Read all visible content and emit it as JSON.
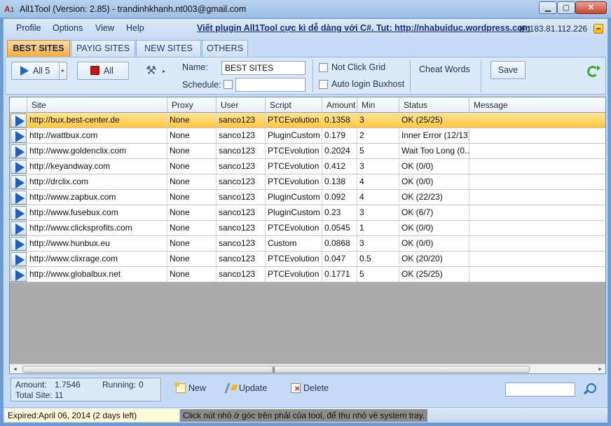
{
  "window": {
    "title": "All1Tool (Version: 2.85) - trandinhkhanh.nt003@gmail.com",
    "logo": "A1",
    "min_glyph": "▁",
    "max_glyph": "▢",
    "close_glyph": "✕"
  },
  "menu": {
    "items": [
      "Profile",
      "Options",
      "View",
      "Help"
    ],
    "link": "Viết plugin All1Tool cực kì dễ dàng với C#. Tut: http://nhabuiduc.wordpress.com",
    "ip": "IP:183.81.112.226"
  },
  "tabs": [
    "BEST SITES",
    "PAYIG SITES",
    "NEW SITES",
    "OTHERS"
  ],
  "toolbar": {
    "all5_label": "All 5",
    "stop_all_label": "All",
    "caret": "▸",
    "name_label": "Name:",
    "name_value": "BEST SITES",
    "schedule_label": "Schedule:",
    "schedule_value": "",
    "not_click_grid": "Not Click Grid",
    "auto_login": "Auto login Buxhost",
    "cheat_words": "Cheat Words",
    "save": "Save"
  },
  "grid": {
    "columns": [
      "Site",
      "Proxy",
      "User",
      "Script",
      "Amount",
      "Min",
      "Status",
      "Message"
    ],
    "rows": [
      {
        "site": "http://bux.best-center.de",
        "proxy": "None",
        "user": "sanco123",
        "script": "PTCEvolution",
        "amount": "0.1358",
        "min": "3",
        "status": "OK (25/25)",
        "message": ""
      },
      {
        "site": "http://wattbux.com",
        "proxy": "None",
        "user": "sanco123",
        "script": "PluginCustom",
        "amount": "0.179",
        "min": "2",
        "status": "Inner Error (12/13)",
        "message": ""
      },
      {
        "site": "http://www.goldenclix.com",
        "proxy": "None",
        "user": "sanco123",
        "script": "PTCEvolution",
        "amount": "0.2024",
        "min": "5",
        "status": "Wait Too Long (0...",
        "message": ""
      },
      {
        "site": "http://keyandway.com",
        "proxy": "None",
        "user": "sanco123",
        "script": "PTCEvolution",
        "amount": "0.412",
        "min": "3",
        "status": "OK (0/0)",
        "message": ""
      },
      {
        "site": "http://drclix.com",
        "proxy": "None",
        "user": "sanco123",
        "script": "PTCEvolution",
        "amount": "0.138",
        "min": "4",
        "status": "OK (0/0)",
        "message": ""
      },
      {
        "site": "http://www.zapbux.com",
        "proxy": "None",
        "user": "sanco123",
        "script": "PluginCustom",
        "amount": "0.092",
        "min": "4",
        "status": "OK (22/23)",
        "message": ""
      },
      {
        "site": "http://www.fusebux.com",
        "proxy": "None",
        "user": "sanco123",
        "script": "PluginCustom",
        "amount": "0.23",
        "min": "3",
        "status": "OK (6/7)",
        "message": ""
      },
      {
        "site": "http://www.clicksprofits.com",
        "proxy": "None",
        "user": "sanco123",
        "script": "PTCEvolution",
        "amount": "0.0545",
        "min": "1",
        "status": "OK (0/0)",
        "message": ""
      },
      {
        "site": "http://www.hunbux.eu",
        "proxy": "None",
        "user": "sanco123",
        "script": "Custom",
        "amount": "0.0868",
        "min": "3",
        "status": "OK (0/0)",
        "message": ""
      },
      {
        "site": "http://www.clixrage.com",
        "proxy": "None",
        "user": "sanco123",
        "script": "PTCEvolution",
        "amount": "0.047",
        "min": "0.5",
        "status": "OK (20/20)",
        "message": ""
      },
      {
        "site": "http://www.globalbux.net",
        "proxy": "None",
        "user": "sanco123",
        "script": "PTCEvolution",
        "amount": "0.1771",
        "min": "5",
        "status": "OK (25/25)",
        "message": ""
      }
    ],
    "selected_row": 0,
    "scroll_left": "◂",
    "scroll_right": "▸",
    "scroll_grip": "|||"
  },
  "summary": {
    "amount_label": "Amount:",
    "amount_value": "1.7546",
    "running_label": "Running:",
    "running_value": "0",
    "total_label": "Total Site:",
    "total_value": "11"
  },
  "actions": {
    "new": "New",
    "update": "Update",
    "delete": "Delete"
  },
  "search": {
    "value": ""
  },
  "status": {
    "expired": "Expired:April 06, 2014 (2 days left)",
    "tip": "Click nút nhỏ ở góc trên phải của tool, để thu nhỏ về system tray."
  },
  "colors": {
    "selected_row": "#ffc83d",
    "active_tab": "#f7a93e",
    "play_icon": "#1f5fbd",
    "stop_icon": "#c41414"
  }
}
